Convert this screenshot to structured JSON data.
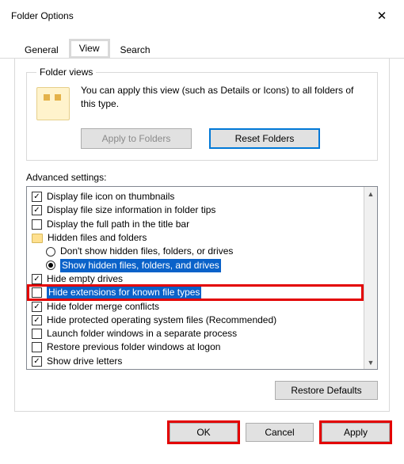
{
  "window": {
    "title": "Folder Options"
  },
  "tabs": {
    "general": "General",
    "view": "View",
    "search": "Search"
  },
  "folder_views": {
    "legend": "Folder views",
    "text": "You can apply this view (such as Details or Icons) to all folders of this type.",
    "apply_btn": "Apply to Folders",
    "reset_btn": "Reset Folders"
  },
  "advanced": {
    "label": "Advanced settings:",
    "items": [
      {
        "kind": "check",
        "checked": true,
        "label": "Display file icon on thumbnails"
      },
      {
        "kind": "check",
        "checked": true,
        "label": "Display file size information in folder tips"
      },
      {
        "kind": "check",
        "checked": false,
        "label": "Display the full path in the title bar"
      },
      {
        "kind": "folder",
        "label": "Hidden files and folders"
      },
      {
        "kind": "radio",
        "indent": 1,
        "selected": false,
        "label": "Don't show hidden files, folders, or drives"
      },
      {
        "kind": "radio",
        "indent": 1,
        "selected": true,
        "label": "Show hidden files, folders, and drives"
      },
      {
        "kind": "check",
        "checked": true,
        "label": "Hide empty drives"
      },
      {
        "kind": "check",
        "checked": false,
        "label": "Hide extensions for known file types",
        "highlighted": true,
        "selected": true
      },
      {
        "kind": "check",
        "checked": true,
        "label": "Hide folder merge conflicts"
      },
      {
        "kind": "check",
        "checked": true,
        "label": "Hide protected operating system files (Recommended)"
      },
      {
        "kind": "check",
        "checked": false,
        "label": "Launch folder windows in a separate process"
      },
      {
        "kind": "check",
        "checked": false,
        "label": "Restore previous folder windows at logon"
      },
      {
        "kind": "check",
        "checked": true,
        "label": "Show drive letters"
      }
    ],
    "restore_btn": "Restore Defaults"
  },
  "buttons": {
    "ok": "OK",
    "cancel": "Cancel",
    "apply": "Apply"
  }
}
